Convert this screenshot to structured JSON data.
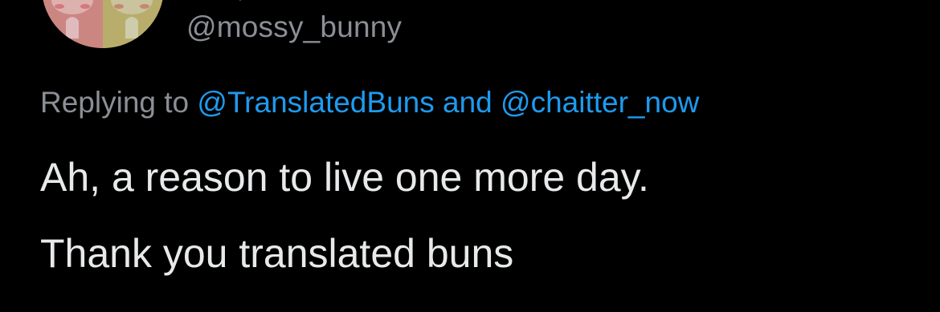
{
  "tweet": {
    "handle": "@mossy_bunny",
    "reply": {
      "prefix": "Replying to ",
      "mention_1": "@TranslatedBuns",
      "joiner": " and ",
      "mention_2": "@chaitter_now"
    },
    "text_lines": [
      "Ah, a reason to live one more day.",
      "Thank you translated buns"
    ]
  },
  "colors": {
    "background": "#000000",
    "secondary_text": "#8b8f95",
    "link": "#1d9bf0",
    "primary_text": "#e7e9ea"
  },
  "icons": {
    "avatar": "profile-avatar-illustration"
  }
}
